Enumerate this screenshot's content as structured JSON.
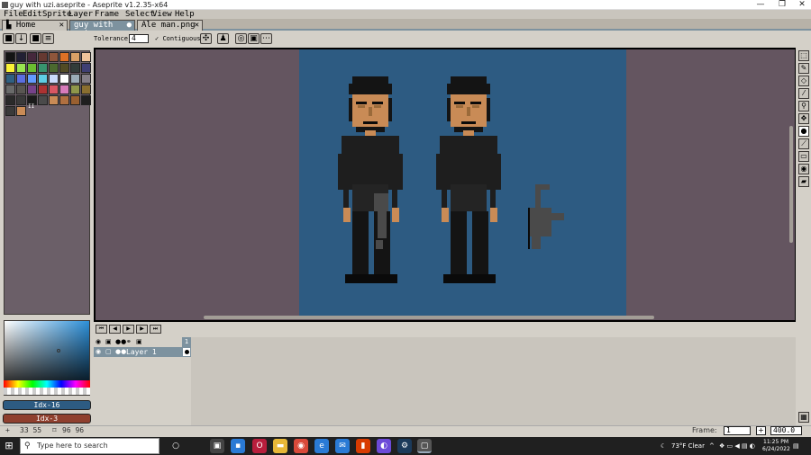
{
  "window": {
    "title": "guy with uzi.aseprite - Aseprite v1.2.35-x64",
    "min": "—",
    "max": "❐",
    "close": "✕"
  },
  "menu": [
    "File",
    "Edit",
    "Sprite",
    "Layer",
    "Frame",
    "Select",
    "View",
    "Help"
  ],
  "tabs": [
    {
      "label": "Home",
      "close": "✕"
    },
    {
      "label": "guy with uzi.as",
      "close": "●"
    },
    {
      "label": "Ale man.png",
      "close": "✕"
    }
  ],
  "context_bar": {
    "tolerance_label": "Tolerance:",
    "tolerance_value": "4",
    "contiguous_label": "Contiguous"
  },
  "palette": {
    "colors": [
      "#141414",
      "#222034",
      "#45283c",
      "#663931",
      "#8f563b",
      "#df7126",
      "#d9a066",
      "#eec39a",
      "#fbf236",
      "#99e550",
      "#6abe30",
      "#37946e",
      "#4b692f",
      "#524b24",
      "#323c39",
      "#3f3f74",
      "#306082",
      "#5b6ee1",
      "#639bff",
      "#5fcde4",
      "#cbdbfc",
      "#ffffff",
      "#9badb7",
      "#847e87",
      "#696a6a",
      "#595652",
      "#76428a",
      "#ac3232",
      "#d95763",
      "#d77bba",
      "#8f974a",
      "#8a6f30",
      "#2a2a2a",
      "#3a3a3a",
      "#1a1a1a",
      "#4a4a4a",
      "#c98b56",
      "#b07040",
      "#9a6030",
      "#1f1f1f",
      "#3a3a3a",
      "#c98b56"
    ],
    "index_marker": "II"
  },
  "color_fg": "Idx-16",
  "color_bg": "Idx-3",
  "colors": {
    "fg": "#2d5b82",
    "bg": "#8f3f2e",
    "skin": "#c98b56",
    "skin_shadow": "#9a6a3a",
    "hair": "#141414",
    "shirt": "#1e1e1e",
    "pants": "#141414",
    "gun": "#4a4a4a",
    "outline": "#0a0a0a",
    "canvas_bg": "#2d5b82"
  },
  "timeline": {
    "layer_name": "Layer 1",
    "frame_number": "1"
  },
  "status": {
    "cursor": "33 55",
    "size": "96 96",
    "frame_label": "Frame:",
    "frame_value": "1",
    "add": "+",
    "zoom": "400.0"
  },
  "taskbar": {
    "search_placeholder": "Type here to search",
    "weather": "73°F  Clear",
    "time": "11:25 PM",
    "date": "6/24/2022"
  }
}
